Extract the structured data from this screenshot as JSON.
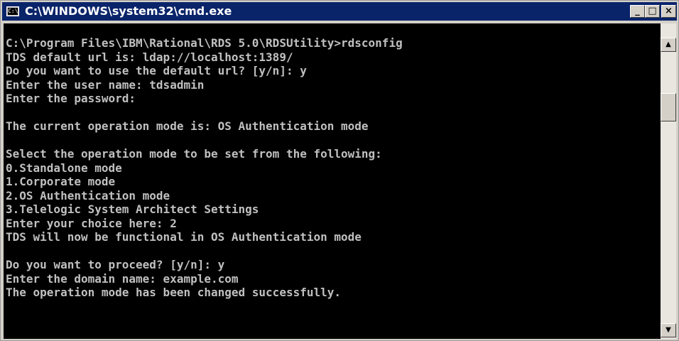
{
  "window": {
    "title": "C:\\WINDOWS\\system32\\cmd.exe",
    "icon": "cmd-icon",
    "icon_text": "C:\\",
    "minimize_glyph": "_",
    "maximize_glyph": "□",
    "close_glyph": "×"
  },
  "console": {
    "lines": [
      "C:\\Program Files\\IBM\\Rational\\RDS 5.0\\RDSUtility>rdsconfig",
      "TDS default url is: ldap://localhost:1389/",
      "Do you want to use the default url? [y/n]: y",
      "Enter the user name: tdsadmin",
      "Enter the password:",
      "",
      "The current operation mode is: OS Authentication mode",
      "",
      "Select the operation mode to be set from the following:",
      "0.Standalone mode",
      "1.Corporate mode",
      "2.OS Authentication mode",
      "3.Telelogic System Architect Settings",
      "Enter your choice here: 2",
      "TDS will now be functional in OS Authentication mode",
      "",
      "Do you want to proceed? [y/n]: y",
      "Enter the domain name: example.com",
      "The operation mode has been changed successfully.",
      ""
    ],
    "text_color": "#c0c0c0",
    "background": "#000000"
  },
  "scrollbar": {
    "up_glyph": "▲",
    "down_glyph": "▼"
  }
}
